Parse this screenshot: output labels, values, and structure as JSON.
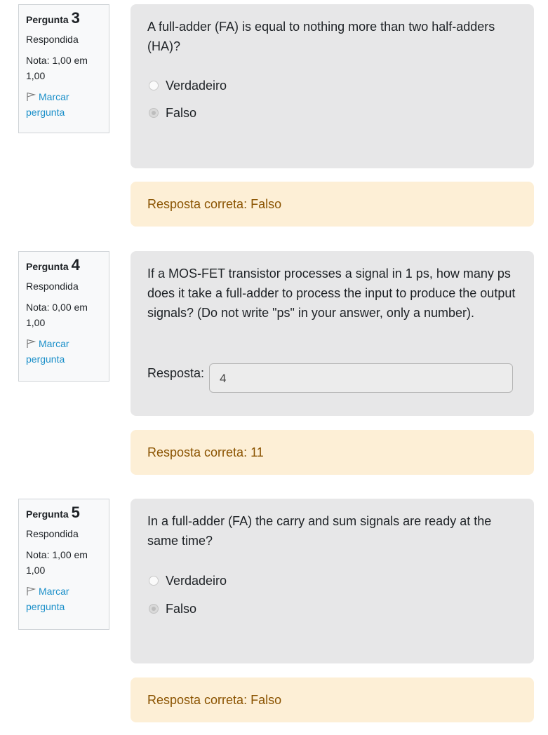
{
  "questions": [
    {
      "label": "Pergunta",
      "number": "3",
      "state": "Respondida",
      "grade": "Nota: 1,00 em 1,00",
      "flag_label": "Marcar pergunta",
      "text": "A full-adder (FA) is equal to nothing more than two half-adders (HA)?",
      "options": [
        {
          "label": "Verdadeiro",
          "checked": false
        },
        {
          "label": "Falso",
          "checked": true
        }
      ],
      "feedback": "Resposta correta: Falso"
    },
    {
      "label": "Pergunta",
      "number": "4",
      "state": "Respondida",
      "grade": "Nota: 0,00 em 1,00",
      "flag_label": "Marcar pergunta",
      "text": "If a MOS-FET transistor processes a signal in 1 ps, how many ps does it take a full-adder to process the input to produce the output signals? (Do not write \"ps\" in your answer, only a number).",
      "answer_label": "Resposta:",
      "answer_value": "4",
      "feedback": "Resposta correta: 11"
    },
    {
      "label": "Pergunta",
      "number": "5",
      "state": "Respondida",
      "grade": "Nota: 1,00 em 1,00",
      "flag_label": "Marcar pergunta",
      "text": "In a full-adder (FA) the carry and sum signals are ready at the same time?",
      "options": [
        {
          "label": "Verdadeiro",
          "checked": false
        },
        {
          "label": "Falso",
          "checked": true
        }
      ],
      "feedback": "Resposta correta: Falso"
    }
  ]
}
